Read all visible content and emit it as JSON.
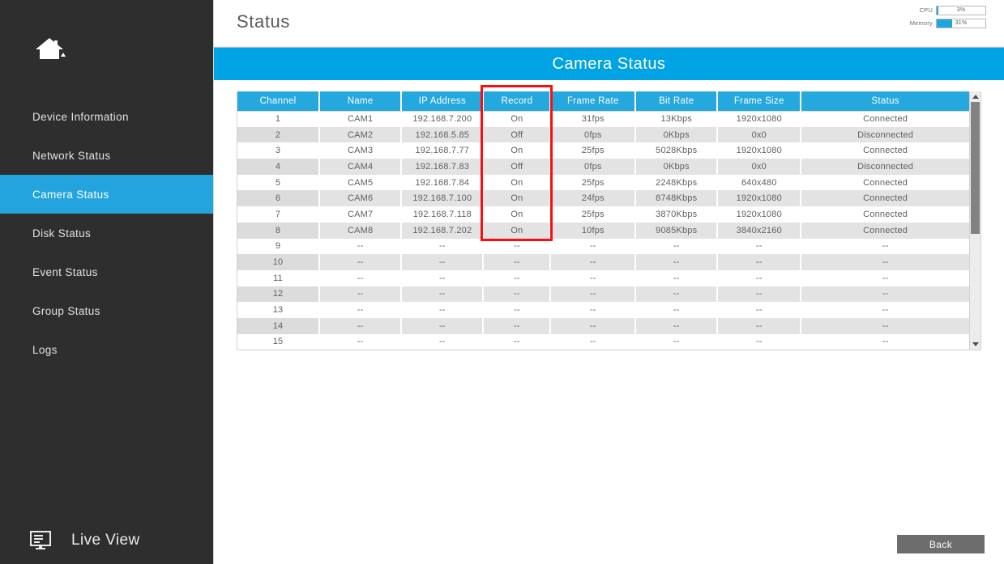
{
  "sidebar": {
    "home_icon": "home-icon",
    "items": [
      {
        "label": "Device Information",
        "active": false
      },
      {
        "label": "Network Status",
        "active": false
      },
      {
        "label": "Camera Status",
        "active": true
      },
      {
        "label": "Disk Status",
        "active": false
      },
      {
        "label": "Event Status",
        "active": false
      },
      {
        "label": "Group Status",
        "active": false
      },
      {
        "label": "Logs",
        "active": false
      }
    ],
    "live_view": {
      "label": "Live View",
      "icon": "monitor-icon"
    }
  },
  "header": {
    "title": "Status",
    "meters": [
      {
        "label": "CPU",
        "value": "3%",
        "percent": 3
      },
      {
        "label": "Memory",
        "value": "31%",
        "percent": 31
      }
    ]
  },
  "banner": {
    "title": "Camera Status"
  },
  "table": {
    "columns": [
      "Channel",
      "Name",
      "IP Address",
      "Record",
      "Frame Rate",
      "Bit Rate",
      "Frame Size",
      "Status"
    ],
    "empty_value": "--",
    "rows": [
      [
        "1",
        "CAM1",
        "192.168.7.200",
        "On",
        "31fps",
        "13Kbps",
        "1920x1080",
        "Connected"
      ],
      [
        "2",
        "CAM2",
        "192.168.5.85",
        "Off",
        "0fps",
        "0Kbps",
        "0x0",
        "Disconnected"
      ],
      [
        "3",
        "CAM3",
        "192.168.7.77",
        "On",
        "25fps",
        "5028Kbps",
        "1920x1080",
        "Connected"
      ],
      [
        "4",
        "CAM4",
        "192.168.7.83",
        "Off",
        "0fps",
        "0Kbps",
        "0x0",
        "Disconnected"
      ],
      [
        "5",
        "CAM5",
        "192.168.7.84",
        "On",
        "25fps",
        "2248Kbps",
        "640x480",
        "Connected"
      ],
      [
        "6",
        "CAM6",
        "192.168.7.100",
        "On",
        "24fps",
        "8748Kbps",
        "1920x1080",
        "Connected"
      ],
      [
        "7",
        "CAM7",
        "192.168.7.118",
        "On",
        "25fps",
        "3870Kbps",
        "1920x1080",
        "Connected"
      ],
      [
        "8",
        "CAM8",
        "192.168.7.202",
        "On",
        "10fps",
        "9085Kbps",
        "3840x2160",
        "Connected"
      ],
      [
        "9",
        "--",
        "--",
        "--",
        "--",
        "--",
        "--",
        "--"
      ],
      [
        "10",
        "--",
        "--",
        "--",
        "--",
        "--",
        "--",
        "--"
      ],
      [
        "11",
        "--",
        "--",
        "--",
        "--",
        "--",
        "--",
        "--"
      ],
      [
        "12",
        "--",
        "--",
        "--",
        "--",
        "--",
        "--",
        "--"
      ],
      [
        "13",
        "--",
        "--",
        "--",
        "--",
        "--",
        "--",
        "--"
      ],
      [
        "14",
        "--",
        "--",
        "--",
        "--",
        "--",
        "--",
        "--"
      ],
      [
        "15",
        "--",
        "--",
        "--",
        "--",
        "--",
        "--",
        "--"
      ]
    ]
  },
  "highlight": {
    "column": "Record"
  },
  "footer": {
    "back_label": "Back"
  },
  "colors": {
    "accent": "#00a3e4",
    "header_blue": "#25a8dd",
    "sidebar_bg": "#2e2e2e",
    "highlight_red": "#fc0d10",
    "meter_fill": "#1fa6e0"
  }
}
